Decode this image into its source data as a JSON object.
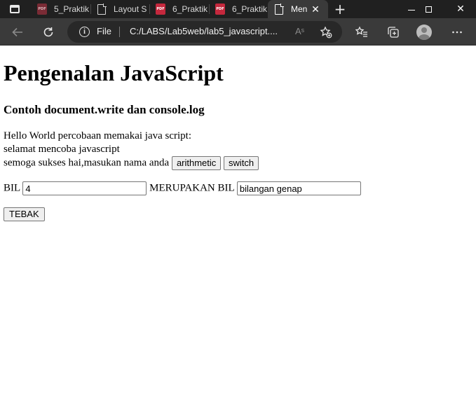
{
  "browser": {
    "tabs": [
      {
        "label": "5_Praktik",
        "icon": "pdf-icon"
      },
      {
        "label": "Layout S",
        "icon": "document-icon"
      },
      {
        "label": "6_Praktik",
        "icon": "pdf-icon"
      },
      {
        "label": "6_Praktik",
        "icon": "pdf-icon"
      },
      {
        "label": "Men",
        "icon": "document-icon",
        "active": true
      }
    ],
    "pdf_badge": "PDF",
    "address": {
      "scheme_label": "File",
      "url": "C:/LABS/Lab5web/lab5_javascript....",
      "read_aloud": "Aˢ"
    }
  },
  "page": {
    "heading": "Pengenalan JavaScript",
    "subheading": "Contoh document.write dan console.log",
    "line1": "Hello World percobaan memakai java script:",
    "line2": "selamat mencoba javascript",
    "line3": "semoga sukses hai,masukan nama anda",
    "button_arithmetic": "arithmetic",
    "button_switch": "switch",
    "bil_label": "BIL",
    "bil_value": "4",
    "merupakan_label": "MERUPAKAN BIL",
    "result_value": "bilangan genap",
    "button_tebak": "TEBAK"
  }
}
